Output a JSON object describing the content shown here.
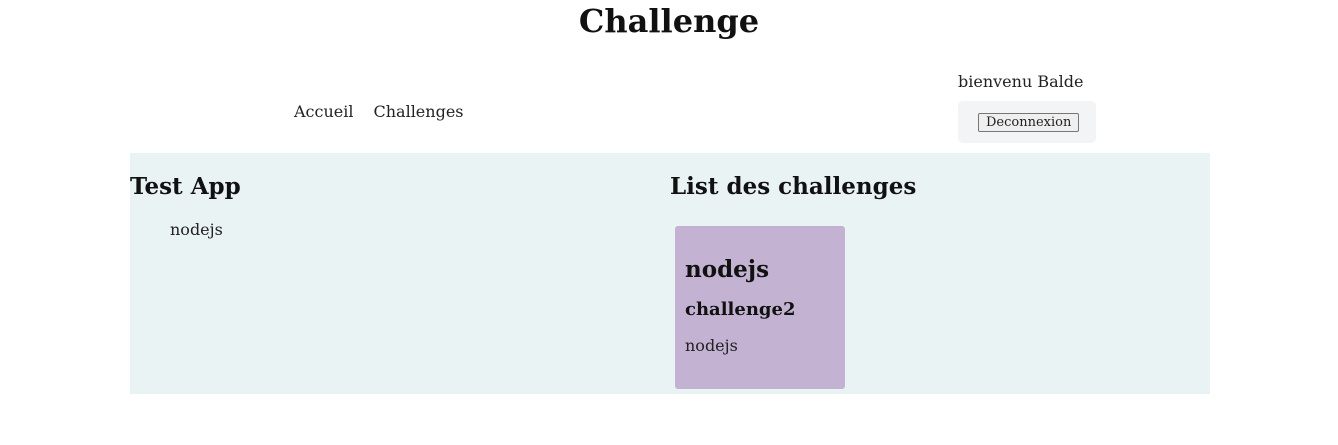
{
  "header": {
    "title": "Challenge"
  },
  "nav": {
    "items": [
      {
        "label": "Accueil"
      },
      {
        "label": "Challenges"
      }
    ]
  },
  "user": {
    "welcome": "bienvenu Balde",
    "logout_label": "Deconnexion"
  },
  "apps": {
    "title": "Test App",
    "items": [
      "nodejs"
    ]
  },
  "challenges": {
    "title": "List des challenges",
    "cards": [
      {
        "title": "nodejs",
        "name": "challenge2",
        "tech": "nodejs"
      }
    ]
  },
  "colors": {
    "main_bg": "#eaf3f4",
    "card_bg": "#c3b2d1",
    "logout_panel_bg": "#f2f4f5"
  }
}
